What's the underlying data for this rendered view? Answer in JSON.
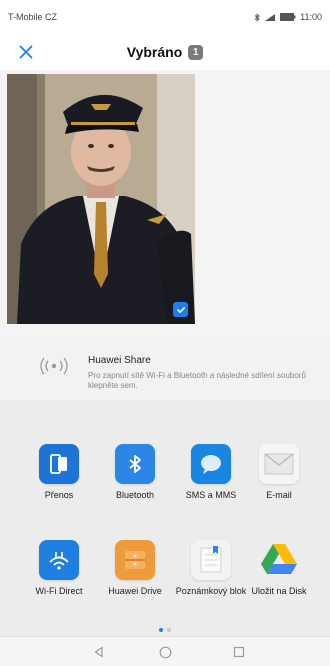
{
  "status_bar": {
    "carrier": "T-Mobile CZ",
    "time": "11:00"
  },
  "header": {
    "title": "Vybráno",
    "selected_count": "1"
  },
  "huawei_share": {
    "title": "Huawei Share",
    "description": "Pro zapnutí sítě Wi-Fi a Bluetooth a následné sdílení souborů klepněte sem."
  },
  "apps": [
    {
      "label": "Přenos",
      "icon": "phone-clone-icon"
    },
    {
      "label": "Bluetooth",
      "icon": "bluetooth-icon"
    },
    {
      "label": "SMS a MMS",
      "icon": "message-icon"
    },
    {
      "label": "E-mail",
      "icon": "envelope-icon"
    },
    {
      "label": "Wi-Fi Direct",
      "icon": "wifi-direct-icon"
    },
    {
      "label": "Huawei Drive",
      "icon": "drive-box-icon"
    },
    {
      "label": "Poznámkový blok",
      "icon": "notepad-icon"
    },
    {
      "label": "Uložit na Disk",
      "icon": "google-drive-icon"
    }
  ],
  "colors": {
    "accent": "#1e7df0",
    "badge": "#7a7a7a",
    "panel": "#ececec"
  }
}
